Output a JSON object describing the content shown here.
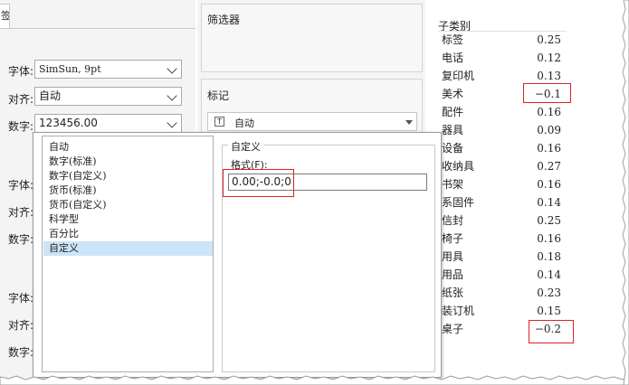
{
  "left_panel": {
    "tab_label": "签",
    "rows": [
      {
        "label": "字体:",
        "value": "SimSun, 9pt"
      },
      {
        "label": "对齐:",
        "value": "自动"
      },
      {
        "label": "数字:",
        "value": "123456.00"
      }
    ],
    "labels_group2": [
      "字体:",
      "对齐:",
      "数字:"
    ],
    "labels_group3": [
      "字体:",
      "对齐:",
      "数字:"
    ]
  },
  "filters": {
    "title": "筛选器"
  },
  "marks": {
    "title": "标记",
    "type_label": "自动"
  },
  "dialog": {
    "categories": [
      "自动",
      "数字(标准)",
      "数字(自定义)",
      "货币(标准)",
      "货币(自定义)",
      "科学型",
      "百分比",
      "自定义"
    ],
    "selected_category": "自定义",
    "group_title": "自定义",
    "format_label": "格式(F):",
    "format_value": "0.00;-0.0;0"
  },
  "table": {
    "header": "子类别",
    "rows": [
      {
        "name": "标签",
        "value": "0.25"
      },
      {
        "name": "电话",
        "value": "0.12"
      },
      {
        "name": "复印机",
        "value": "0.13"
      },
      {
        "name": "美术",
        "value": "−0.1"
      },
      {
        "name": "配件",
        "value": "0.16"
      },
      {
        "name": "器具",
        "value": "0.09"
      },
      {
        "name": "设备",
        "value": "0.16"
      },
      {
        "name": "收纳具",
        "value": "0.27"
      },
      {
        "name": "书架",
        "value": "0.16"
      },
      {
        "name": "系固件",
        "value": "0.14"
      },
      {
        "name": "信封",
        "value": "0.25"
      },
      {
        "name": "椅子",
        "value": "0.16"
      },
      {
        "name": "用具",
        "value": "0.18"
      },
      {
        "name": "用品",
        "value": "0.14"
      },
      {
        "name": "纸张",
        "value": "0.23"
      },
      {
        "name": "装订机",
        "value": "0.15"
      },
      {
        "name": "桌子",
        "value": "−0.2"
      }
    ]
  },
  "colors": {
    "highlight_box": "#dd2222",
    "selection": "#cce4f7"
  }
}
